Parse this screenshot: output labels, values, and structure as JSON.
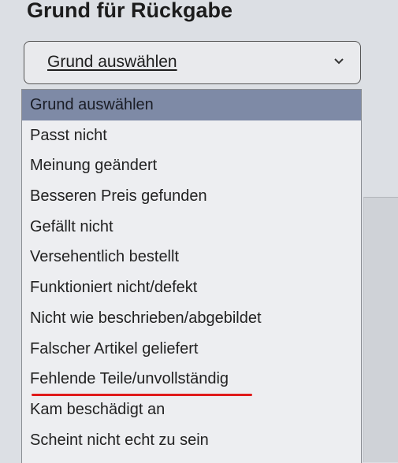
{
  "page": {
    "title": "Grund für Rückgabe"
  },
  "select": {
    "value": "Grund auswählen",
    "icon": "chevron-down-icon"
  },
  "options": [
    "Grund auswählen",
    "Passt nicht",
    "Meinung geändert",
    "Besseren Preis gefunden",
    "Gefällt nicht",
    "Versehentlich bestellt",
    "Funktioniert nicht/defekt",
    "Nicht wie beschrieben/abgebildet",
    "Falscher Artikel geliefert",
    "Fehlende Teile/unvollständig",
    "Kam beschädigt an",
    "Scheint nicht echt zu sein"
  ],
  "colors": {
    "highlight": "#7e8aa6",
    "annotation": "#e01a1a"
  }
}
